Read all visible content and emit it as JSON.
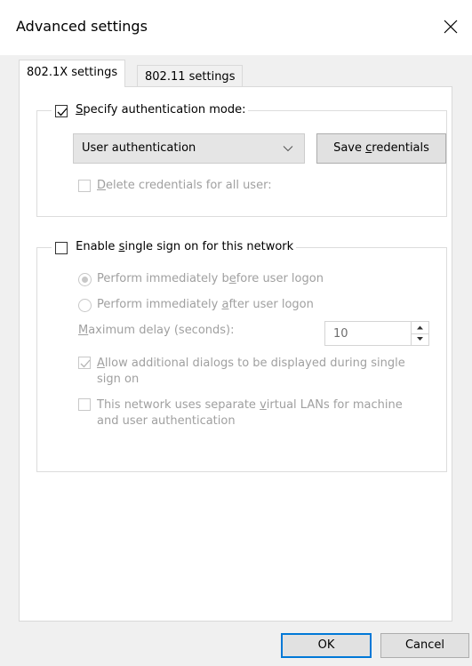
{
  "window": {
    "title": "Advanced settings"
  },
  "tabs": [
    {
      "label": "802.1X settings",
      "active": true
    },
    {
      "label": "802.11 settings",
      "active": false
    }
  ],
  "auth_group": {
    "specify_mode": {
      "label_pre": "",
      "label_ul": "S",
      "label_post": "pecify authentication mode:",
      "checked": true
    },
    "mode_select": {
      "value": "User authentication",
      "options": [
        "User authentication"
      ]
    },
    "save_credentials": {
      "label_pre": "Save ",
      "label_ul": "c",
      "label_post": "redentials"
    },
    "delete_credentials": {
      "label_pre": "",
      "label_ul": "D",
      "label_post": "elete credentials for all user:",
      "checked": false,
      "enabled": false
    }
  },
  "sso_group": {
    "enable_sso": {
      "label_pre": "Enable ",
      "label_ul": "s",
      "label_post": "ingle sign on for this network",
      "checked": false
    },
    "radio_before": {
      "label_pre": "Perform immediately b",
      "label_ul": "e",
      "label_post": "fore user logon",
      "selected": true,
      "enabled": false
    },
    "radio_after": {
      "label_pre": "Perform immediately ",
      "label_ul": "a",
      "label_post": "fter user logon",
      "selected": false,
      "enabled": false
    },
    "max_delay": {
      "label_pre": "",
      "label_ul": "M",
      "label_post": "aximum delay (seconds):",
      "value": "10",
      "enabled": false
    },
    "allow_dialogs": {
      "line1_pre": "",
      "line1_ul": "A",
      "line1_post": "llow additional dialogs to be displayed during single",
      "line2": "sign on",
      "checked": true,
      "enabled": false
    },
    "separate_vlans": {
      "line1_pre": "This network uses separate ",
      "line1_ul": "v",
      "line1_post": "irtual LANs for machine",
      "line2": "and user authentication",
      "checked": false,
      "enabled": false
    }
  },
  "footer": {
    "ok_label": "OK",
    "cancel_label": "Cancel"
  },
  "colors": {
    "accent": "#0078d7",
    "disabled_text": "#a0a0a0",
    "dialog_bg": "#f0f0f0"
  },
  "icons": {
    "close": "close-icon",
    "dropdown": "chevron-down-icon",
    "check": "checkmark-icon"
  }
}
